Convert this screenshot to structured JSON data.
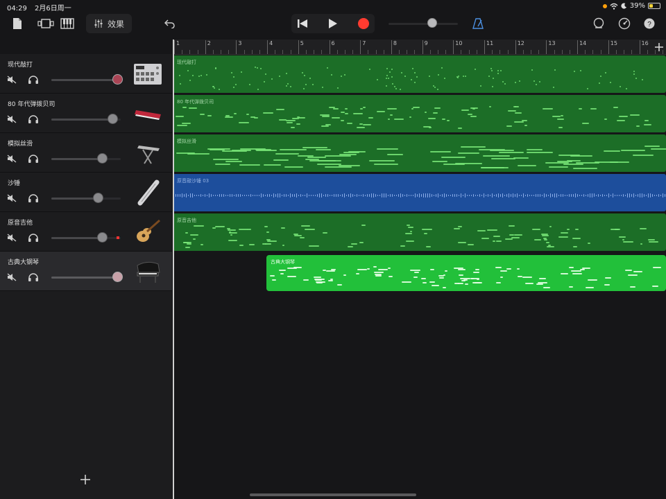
{
  "status_bar": {
    "time": "04:29",
    "date": "2月6日周一",
    "battery": "39%"
  },
  "toolbar": {
    "effects_label": "效果"
  },
  "ruler": {
    "bars": [
      "1",
      "2",
      "3",
      "4",
      "5",
      "6",
      "7",
      "8",
      "9",
      "10",
      "11",
      "12",
      "13",
      "14",
      "15",
      "16"
    ]
  },
  "tracks": [
    {
      "name": "现代敲打",
      "region_label": "现代敲打",
      "color": "#1f7a2a"
    },
    {
      "name": "80 年代弹拨贝司",
      "region_label": "80 年代弹拨贝司",
      "color": "#1f7a2a"
    },
    {
      "name": "模拟丝滑",
      "region_label": "模拟丝滑",
      "color": "#1f7a2a"
    },
    {
      "name": "沙锤",
      "region_label": "原音敲沙锤 03",
      "color": "#1f4f9e"
    },
    {
      "name": "原音吉他",
      "region_label": "原音吉他",
      "color": "#1f7a2a"
    },
    {
      "name": "古典大钢琴",
      "region_label": "古典大钢琴",
      "color": "#22c03a"
    }
  ],
  "colors": {
    "accent_green": "#22c03a",
    "record_red": "#ff3b30",
    "audio_blue": "#1f4f9e"
  }
}
